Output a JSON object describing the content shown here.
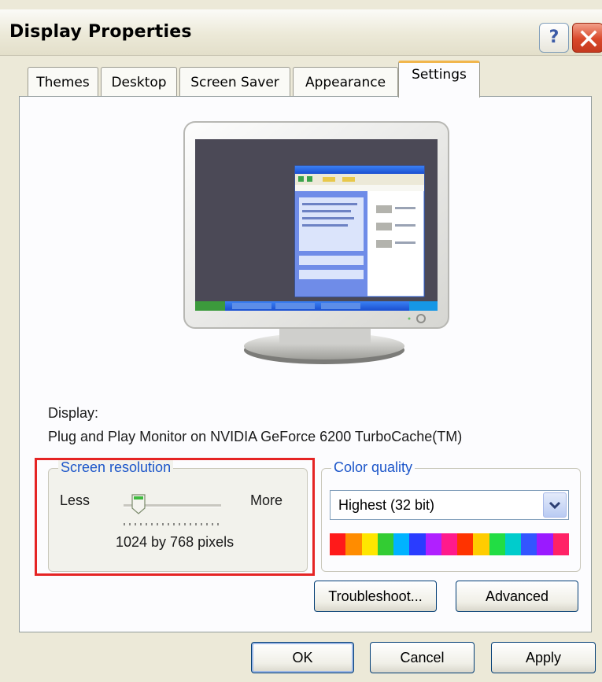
{
  "window": {
    "title": "Display Properties",
    "help_glyph": "?",
    "close_icon": "close-icon"
  },
  "tabs": [
    {
      "label": "Themes"
    },
    {
      "label": "Desktop"
    },
    {
      "label": "Screen Saver"
    },
    {
      "label": "Appearance"
    },
    {
      "label": "Settings",
      "active": true
    }
  ],
  "settings": {
    "display_label": "Display:",
    "display_device": "Plug and Play Monitor on NVIDIA GeForce 6200 TurboCache(TM)",
    "screen_resolution": {
      "legend": "Screen resolution",
      "less_label": "Less",
      "more_label": "More",
      "value_text": "1024 by 768 pixels",
      "slider_position": 0.15
    },
    "color_quality": {
      "legend": "Color quality",
      "selected": "Highest (32 bit)",
      "palette": [
        "#ff1a1a",
        "#ff8c00",
        "#ffe600",
        "#33cc33",
        "#00b3ff",
        "#2a3cff",
        "#b020ff",
        "#ff1a8c",
        "#ff3300",
        "#ffcc00",
        "#22dd44",
        "#00cccc",
        "#3355ff",
        "#9a1aff",
        "#ff2266"
      ]
    },
    "troubleshoot_label": "Troubleshoot...",
    "advanced_label": "Advanced"
  },
  "buttons": {
    "ok": "OK",
    "cancel": "Cancel",
    "apply": "Apply"
  },
  "accent_colors": {
    "legend_blue": "#1b55c9",
    "highlight_red": "#e52424",
    "active_tab_orange": "#f1b64d"
  }
}
